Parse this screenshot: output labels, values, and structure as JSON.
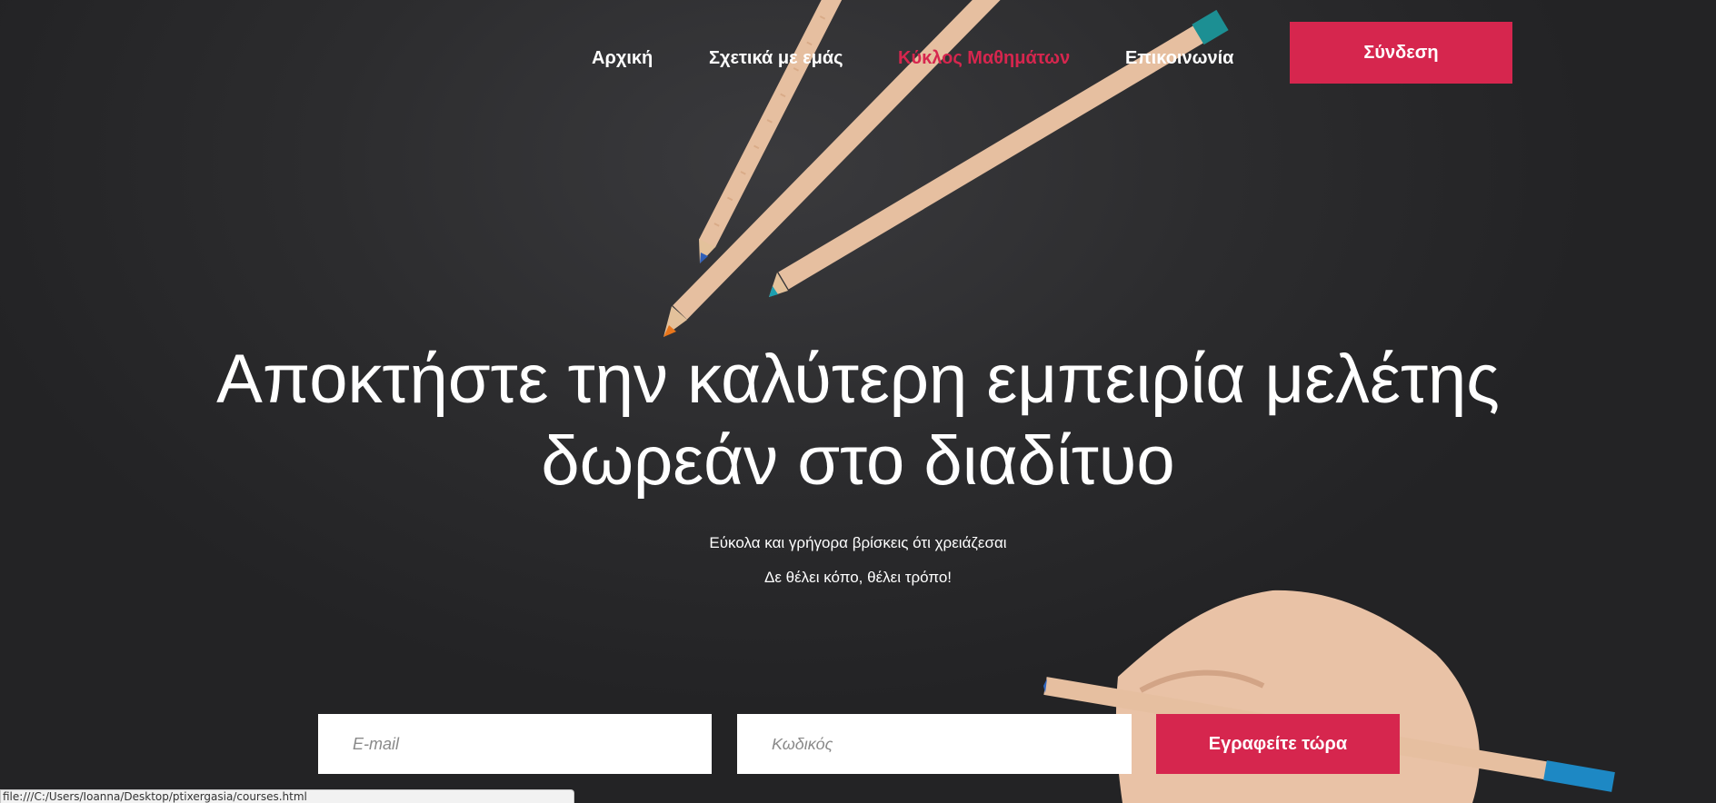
{
  "nav": {
    "items": [
      {
        "label": "Αρχική",
        "active": false
      },
      {
        "label": "Σχετικά με εμάς",
        "active": false
      },
      {
        "label": "Κύκλος Μαθημάτων",
        "active": true
      },
      {
        "label": "Επικοινωνία",
        "active": false
      }
    ],
    "login_label": "Σύνδεση"
  },
  "hero": {
    "headline_line1": "Αποκτήστε την καλύτερη εμπειρία μελέτης",
    "headline_line2": "δωρεάν στο διαδίτυο",
    "subtitle_line1": "Εύκολα και γρήγορα βρίσκεις ότι χρειάζεσαι",
    "subtitle_line2": "Δε θέλει κόπο, θέλει τρόπο!"
  },
  "signup_form": {
    "email_placeholder": "E-mail",
    "password_placeholder": "Κωδικός",
    "submit_label": "Εγραφείτε τώρα"
  },
  "status_bar": {
    "url": "file:///C:/Users/Ioanna/Desktop/ptixergasia/courses.html"
  },
  "colors": {
    "accent": "#d6264e",
    "background": "#2b2b2d",
    "text": "#ffffff"
  }
}
